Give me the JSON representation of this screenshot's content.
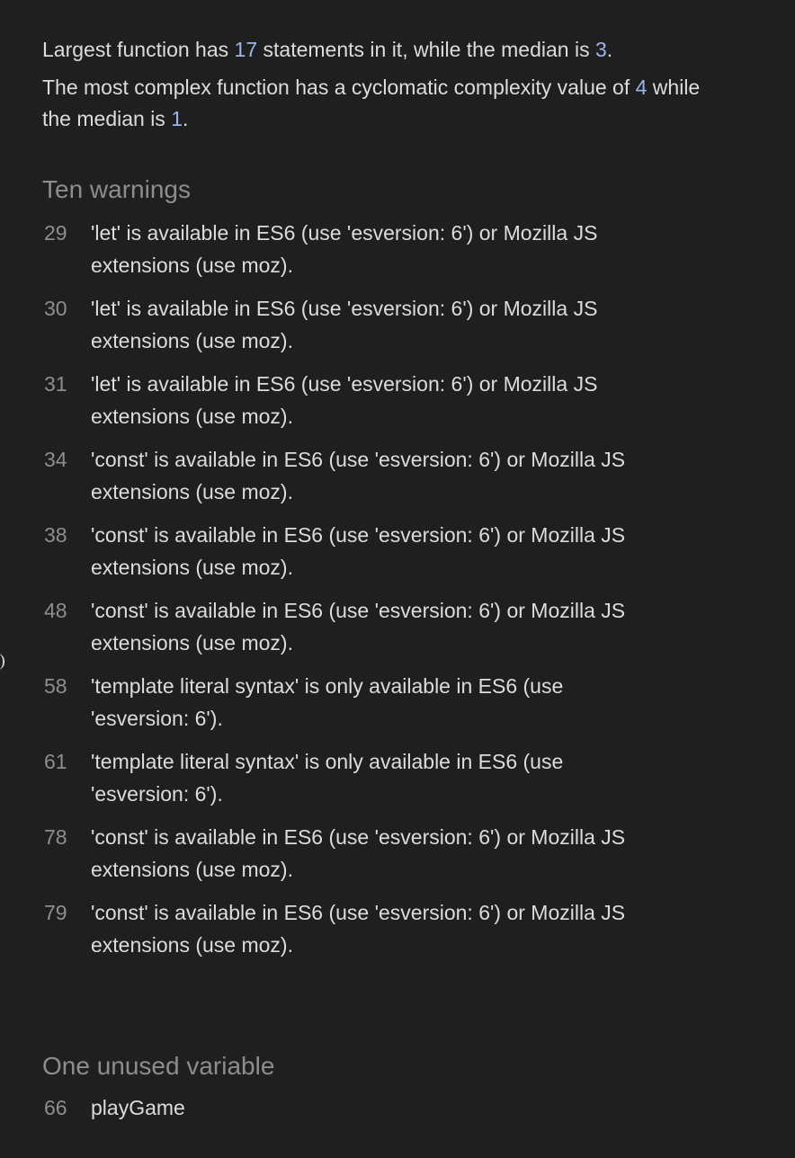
{
  "metrics": {
    "statements_prefix": "Largest function has ",
    "largest_statements": "17",
    "statements_middle": " statements in it, while the median is ",
    "median_statements": "3",
    "statements_suffix": ".",
    "complexity_prefix": "The most complex function has a cyclomatic complexity value of ",
    "max_complexity": "4",
    "complexity_middle": " while the median is ",
    "median_complexity": "1",
    "complexity_suffix": "."
  },
  "warnings": {
    "title": "Ten warnings",
    "items": [
      {
        "line": "29",
        "message": "'let' is available in ES6 (use 'esversion: 6') or Mozilla JS extensions (use moz)."
      },
      {
        "line": "30",
        "message": "'let' is available in ES6 (use 'esversion: 6') or Mozilla JS extensions (use moz)."
      },
      {
        "line": "31",
        "message": "'let' is available in ES6 (use 'esversion: 6') or Mozilla JS extensions (use moz)."
      },
      {
        "line": "34",
        "message": "'const' is available in ES6 (use 'esversion: 6') or Mozilla JS extensions (use moz)."
      },
      {
        "line": "38",
        "message": "'const' is available in ES6 (use 'esversion: 6') or Mozilla JS extensions (use moz)."
      },
      {
        "line": "48",
        "message": "'const' is available in ES6 (use 'esversion: 6') or Mozilla JS extensions (use moz)."
      },
      {
        "line": "58",
        "message": "'template literal syntax' is only available in ES6 (use 'esversion: 6')."
      },
      {
        "line": "61",
        "message": "'template literal syntax' is only available in ES6 (use 'esversion: 6')."
      },
      {
        "line": "78",
        "message": "'const' is available in ES6 (use 'esversion: 6') or Mozilla JS extensions (use moz)."
      },
      {
        "line": "79",
        "message": "'const' is available in ES6 (use 'esversion: 6') or Mozilla JS extensions (use moz)."
      }
    ]
  },
  "unused": {
    "title": "One unused variable",
    "items": [
      {
        "line": "66",
        "name": "playGame"
      }
    ]
  },
  "colors": {
    "background": "#1f1f1f",
    "text": "#dcdcdc",
    "muted": "#8d8d8d",
    "number_accent": "#9bb6e8"
  }
}
